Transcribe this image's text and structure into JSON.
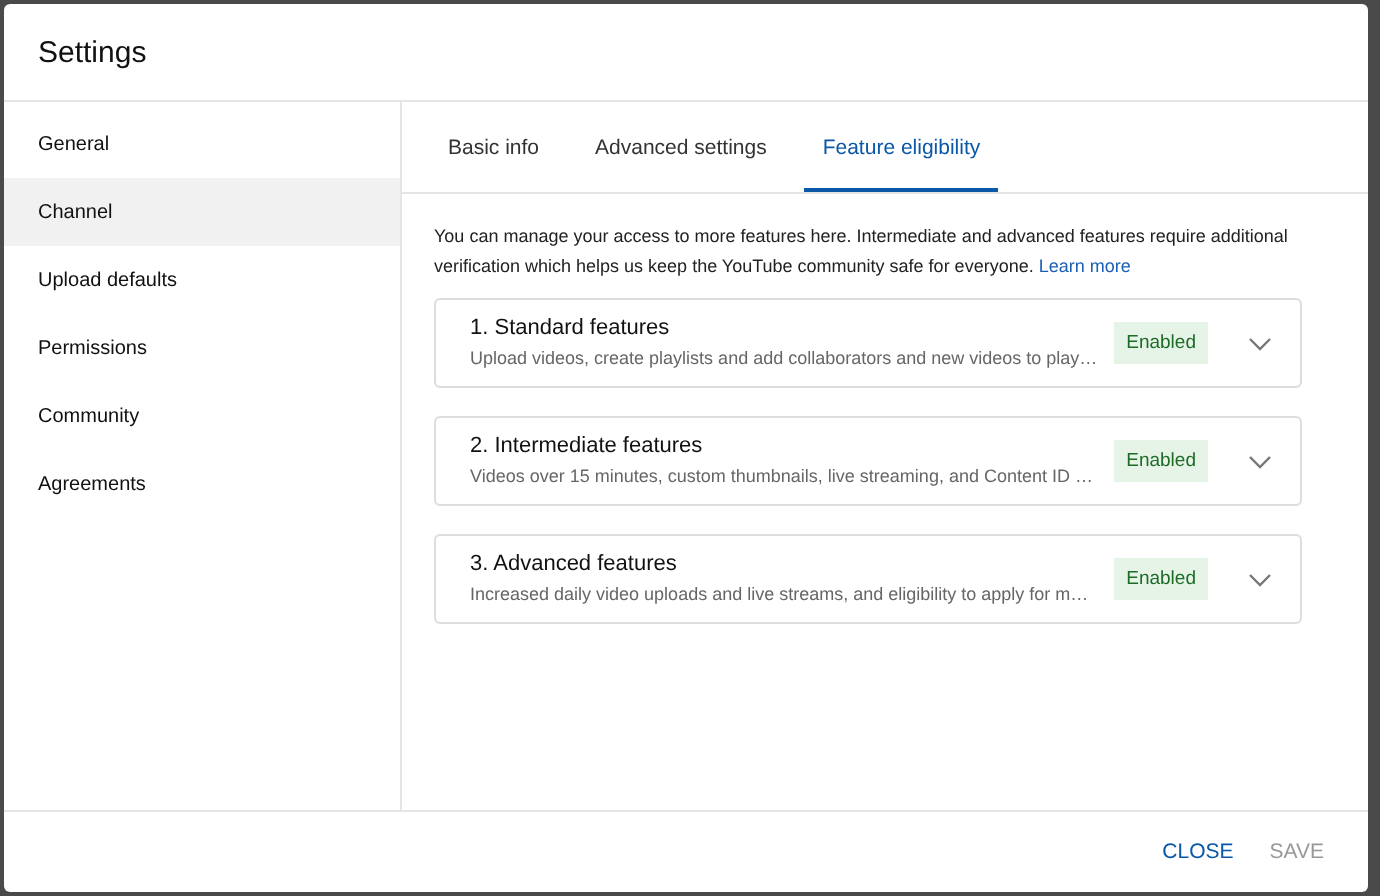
{
  "dialog": {
    "title": "Settings"
  },
  "sidebar": {
    "items": [
      {
        "label": "General",
        "selected": false
      },
      {
        "label": "Channel",
        "selected": true
      },
      {
        "label": "Upload defaults",
        "selected": false
      },
      {
        "label": "Permissions",
        "selected": false
      },
      {
        "label": "Community",
        "selected": false
      },
      {
        "label": "Agreements",
        "selected": false
      }
    ]
  },
  "tabs": [
    {
      "label": "Basic info",
      "selected": false
    },
    {
      "label": "Advanced settings",
      "selected": false
    },
    {
      "label": "Feature eligibility",
      "selected": true
    }
  ],
  "intro": {
    "text": "You can manage your access to more features here. Intermediate and advanced features require additional verification which helps us keep the YouTube community safe for everyone.",
    "link": "Learn more"
  },
  "features": [
    {
      "title": "1. Standard features",
      "description": "Upload videos, create playlists and add collaborators and new videos to play…",
      "status": "Enabled",
      "expanded": false
    },
    {
      "title": "2. Intermediate features",
      "description": "Videos over 15 minutes, custom thumbnails, live streaming, and Content ID …",
      "status": "Enabled",
      "expanded": false
    },
    {
      "title": "3. Advanced features",
      "description": "Increased daily video uploads and live streams, and eligibility to apply for m…",
      "status": "Enabled",
      "expanded": false
    }
  ],
  "footer": {
    "buttons": [
      {
        "label": "CLOSE",
        "disabled": false
      },
      {
        "label": "SAVE",
        "disabled": true
      }
    ]
  }
}
